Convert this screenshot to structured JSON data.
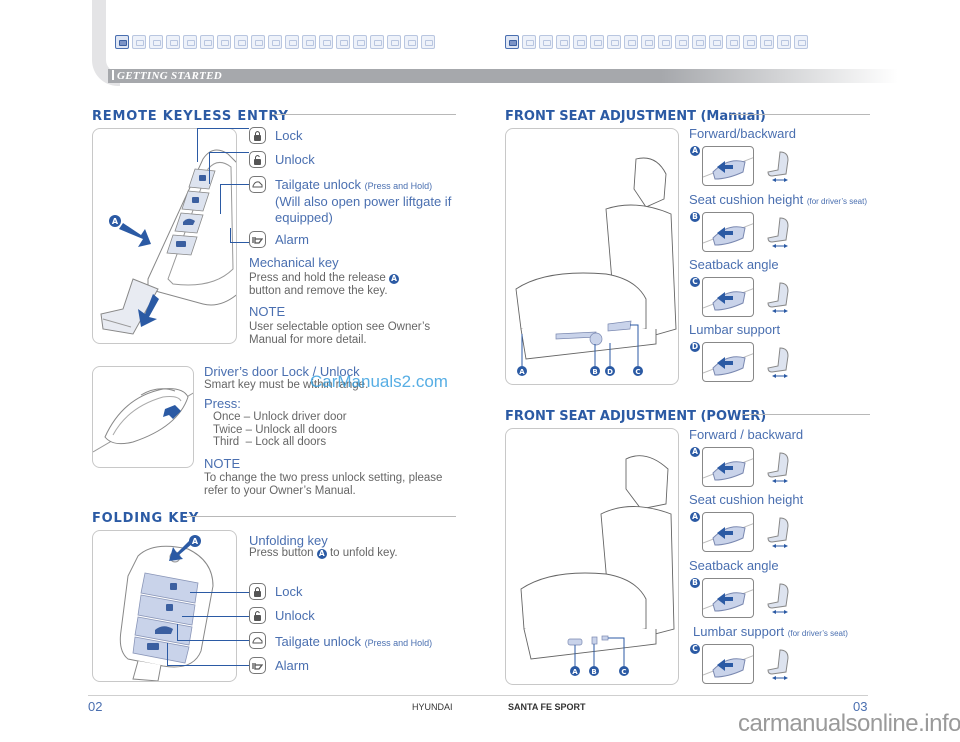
{
  "header": {
    "section_title": "GETTING STARTED",
    "left_icon_count": 19,
    "right_icon_count": 18,
    "left_active_icon": 0,
    "right_active_icon": 0
  },
  "remote_keyless_entry": {
    "title": "REMOTE KEYLESS ENTRY",
    "buttons": [
      {
        "icon": "lock-icon",
        "label": "Lock",
        "note": ""
      },
      {
        "icon": "unlock-icon",
        "label": "Unlock",
        "note": ""
      },
      {
        "icon": "tailgate-icon",
        "label": "Tailgate unlock",
        "note": "(Press and Hold)",
        "extra": "(Will also open power liftgate if equipped)"
      },
      {
        "icon": "alarm-icon",
        "label": "Alarm",
        "note": ""
      }
    ],
    "callout": "A",
    "mechanical_key": {
      "heading": "Mechanical key",
      "text_before_badge": "Press and hold the release",
      "badge": "A",
      "text_after": "button and remove the key."
    },
    "note": {
      "heading": "NOTE",
      "text": "User selectable option see Owner’s Manual for more detail."
    }
  },
  "drivers_door": {
    "heading": "Driver’s door Lock / Unlock",
    "text": "Smart key must be within range.",
    "press_heading": "Press:",
    "press_items": [
      {
        "count": "Once",
        "action": "Unlock driver door"
      },
      {
        "count": "Twice",
        "action": "Unlock all doors"
      },
      {
        "count": "Third",
        "action": "Lock all doors"
      }
    ],
    "note_heading": "NOTE",
    "note_text": "To change the two press unlock setting, please refer to your Owner’s Manual."
  },
  "folding_key": {
    "title": "FOLDING KEY",
    "callout": "A",
    "unfold_heading": "Unfolding key",
    "unfold_text_before": "Press button",
    "unfold_badge": "A",
    "unfold_text_after": "to unfold key.",
    "buttons": [
      {
        "icon": "lock-icon",
        "label": "Lock",
        "note": ""
      },
      {
        "icon": "unlock-icon",
        "label": "Unlock",
        "note": ""
      },
      {
        "icon": "tailgate-icon",
        "label": "Tailgate unlock",
        "note": "(Press and Hold)"
      },
      {
        "icon": "alarm-icon",
        "label": "Alarm",
        "note": ""
      }
    ]
  },
  "front_seat_manual": {
    "title": "FRONT SEAT ADJUSTMENT (Manual)",
    "callouts": [
      "A",
      "B",
      "D",
      "C"
    ],
    "items": [
      {
        "label": "Forward/backward",
        "note": "",
        "badge": "A"
      },
      {
        "label": "Seat cushion height",
        "note": "(for driver’s seat)",
        "badge": "B"
      },
      {
        "label": "Seatback angle",
        "note": "",
        "badge": "C"
      },
      {
        "label": "Lumbar support",
        "note": "",
        "badge": "D"
      }
    ]
  },
  "front_seat_power": {
    "title": "FRONT SEAT ADJUSTMENT (POWER)",
    "callouts": [
      "A",
      "B",
      "C"
    ],
    "items": [
      {
        "label": "Forward / backward",
        "note": "",
        "badge": "A"
      },
      {
        "label": "Seat cushion height",
        "note": "",
        "badge": "A"
      },
      {
        "label": "Seatback angle",
        "note": "",
        "badge": "B"
      },
      {
        "label": "Lumbar support",
        "note": "(for driver’s seat)",
        "badge": "C"
      }
    ]
  },
  "footer": {
    "page_left": "02",
    "page_right": "03",
    "brand": "HYUNDAI",
    "model": "SANTA FE SPORT"
  },
  "watermarks": {
    "overlay": "CarManuals2.com",
    "bottom": "carmanualsonline.info"
  }
}
